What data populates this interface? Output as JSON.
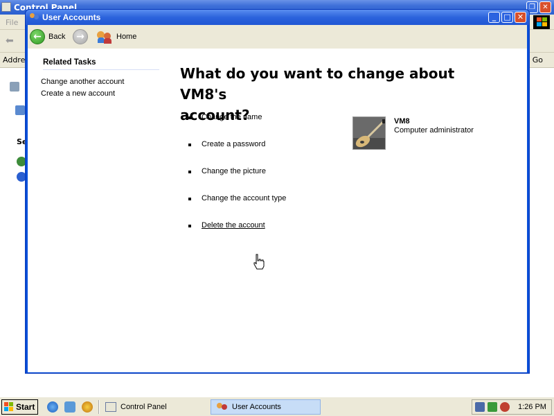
{
  "background_window": {
    "title": "Control Panel",
    "menu_file": "File",
    "address_label": "Addres",
    "go_label": "Go",
    "left_section_fragment": "Se"
  },
  "window": {
    "title": "User Accounts",
    "controls": {
      "minimize": "_",
      "maximize": "□",
      "close": "✕"
    }
  },
  "nav": {
    "back_label": "Back",
    "home_label": "Home"
  },
  "sidebar": {
    "header": "Related Tasks",
    "links": [
      "Change another account",
      "Create a new account"
    ]
  },
  "main": {
    "heading_line1": "What do you want to change about VM8's",
    "heading_line2": "account?",
    "tasks": [
      {
        "label": "Change the name"
      },
      {
        "label": "Create a password"
      },
      {
        "label": "Change the picture"
      },
      {
        "label": "Change the account type"
      },
      {
        "label": "Delete the account"
      }
    ]
  },
  "account": {
    "name": "VM8",
    "type": "Computer administrator",
    "picture_icon": "guitar-picture"
  },
  "taskbar": {
    "start_label": "Start",
    "buttons": [
      "Control Panel",
      "User Accounts"
    ],
    "active_button": "User Accounts",
    "clock": "1:26 PM"
  },
  "colors": {
    "titlebar_blue": "#2c63dc",
    "window_border_blue": "#0a4ed8",
    "panel_bg": "#ece9d8",
    "close_red": "#d8502a",
    "active_task_bg": "#c7ddf7"
  }
}
